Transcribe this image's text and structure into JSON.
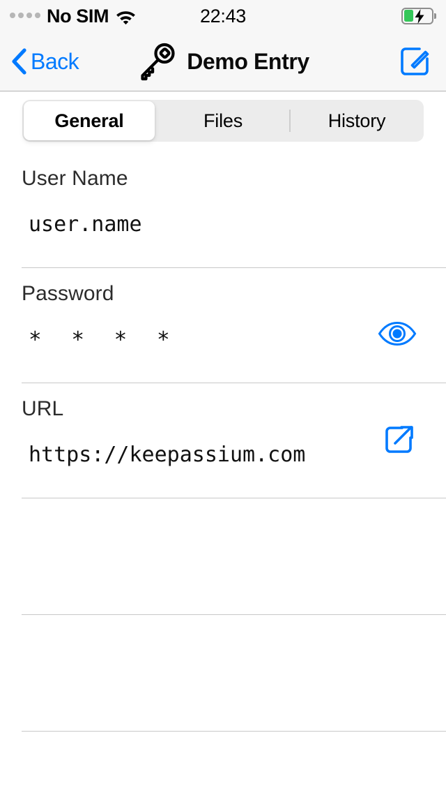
{
  "status_bar": {
    "signal_icon": "signal-dots-inactive",
    "carrier": "No SIM",
    "wifi_icon": "wifi-icon",
    "time": "22:43",
    "battery_icon": "battery-charging-icon",
    "battery_level_percent": 35,
    "battery_color": "#34c759"
  },
  "nav_bar": {
    "back_icon": "chevron-left-icon",
    "back_label": "Back",
    "title_icon": "key-icon",
    "title": "Demo Entry",
    "edit_icon": "square-and-pencil-icon",
    "accent_color": "#007aff"
  },
  "segmented_control": {
    "items": [
      {
        "label": "General",
        "selected": true
      },
      {
        "label": "Files",
        "selected": false
      },
      {
        "label": "History",
        "selected": false
      }
    ]
  },
  "fields": [
    {
      "label": "User Name",
      "value": "user.name",
      "action_icon": null
    },
    {
      "label": "Password",
      "value": "* * * *",
      "masked": true,
      "action_icon": "eye-icon"
    },
    {
      "label": "URL",
      "value": "https://keepassium.com",
      "action_icon": "external-link-icon"
    }
  ],
  "empty_rows": 2
}
